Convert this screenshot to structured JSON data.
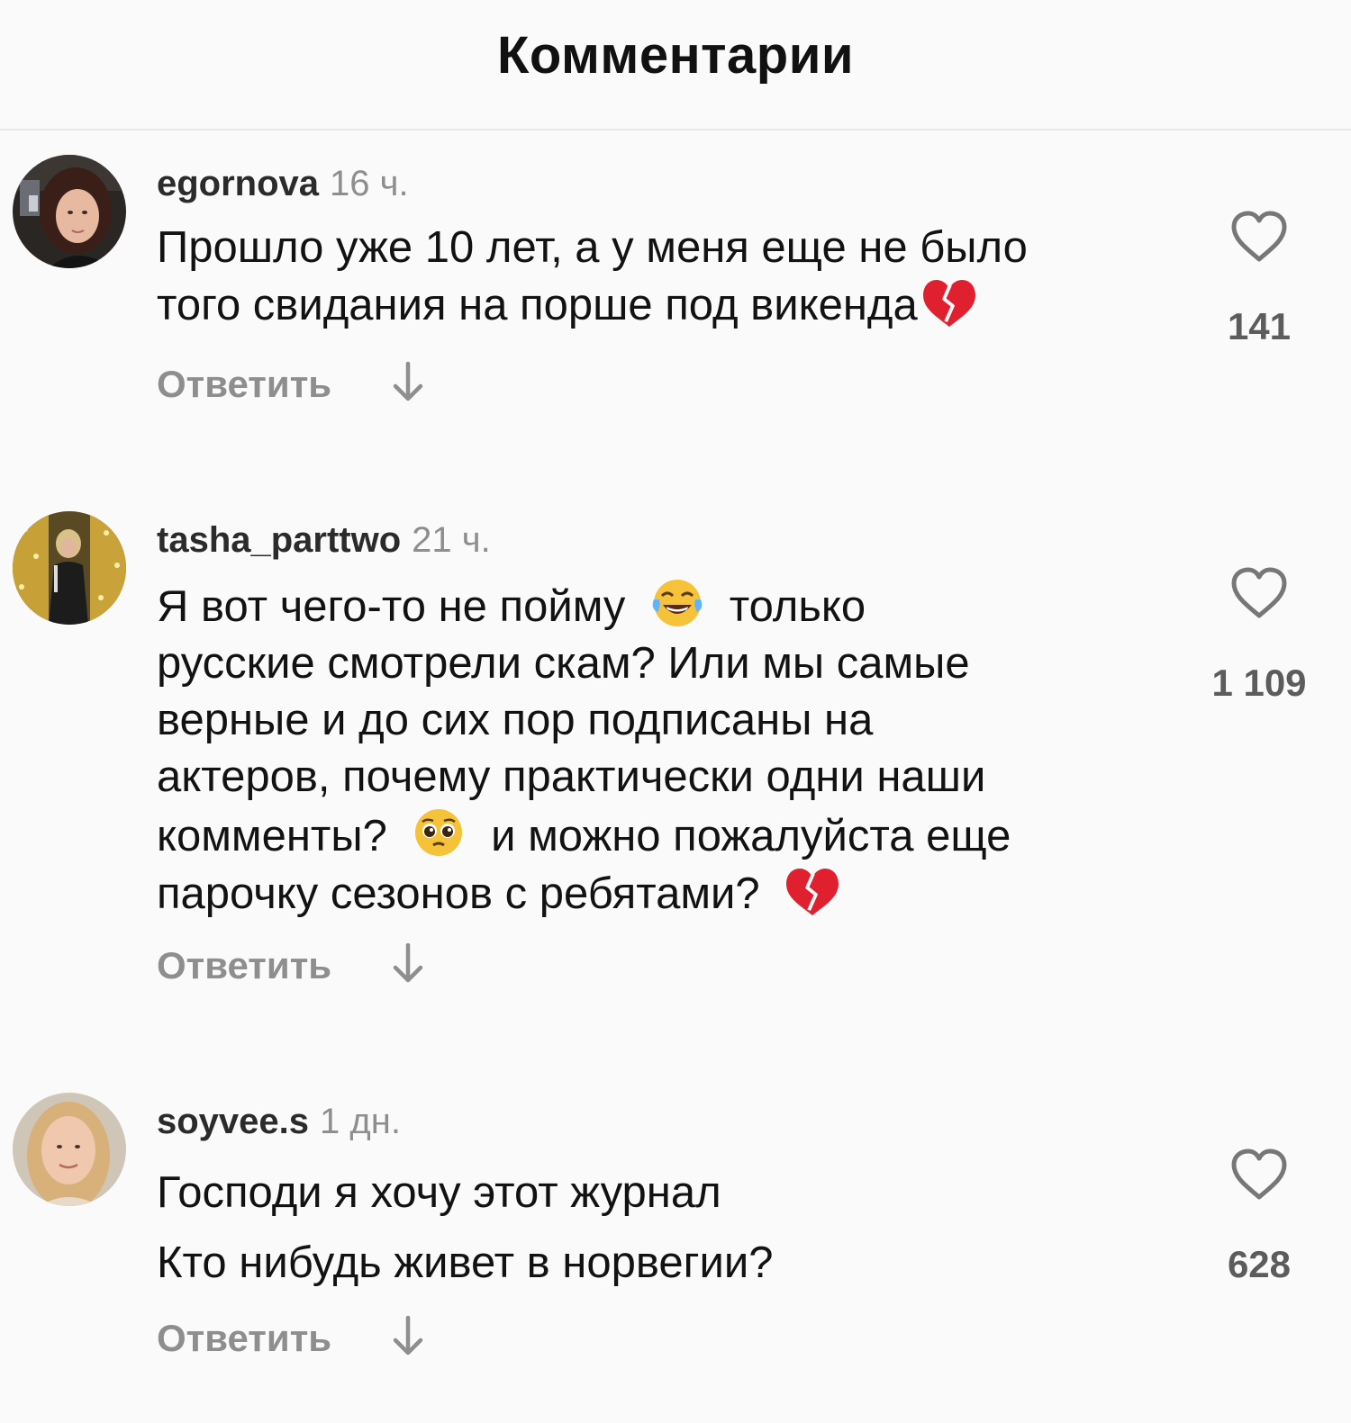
{
  "header": {
    "title": "Комментарии"
  },
  "comments": [
    {
      "username": "egornova",
      "time": "16 ч.",
      "lines": [
        "Прошло уже 10 лет, а у меня еще не было",
        "того свидания на порше под викенда"
      ],
      "emojis": [
        "broken-heart"
      ],
      "likes": "141",
      "reply_label": "Ответить"
    },
    {
      "username": "tasha_parttwo",
      "time": "21 ч.",
      "lines": [
        "Я вот чего-то не пойму",
        "только",
        "русские смотрели скам? Или мы самые",
        "верные и до сих пор подписаны на",
        "актеров, почему практически одни наши",
        "комменты?",
        "и можно пожалуйста еще",
        "парочку сезонов с ребятами?"
      ],
      "emojis": [
        "face-with-tears-of-joy",
        "pleading-face",
        "broken-heart"
      ],
      "likes": "1 109",
      "reply_label": "Ответить"
    },
    {
      "username": "soyvee.s",
      "time": "1 дн.",
      "lines": [
        "Господи я хочу этот журнал",
        "Кто нибудь живет в норвегии?"
      ],
      "emojis": [],
      "likes": "628",
      "reply_label": "Ответить"
    }
  ],
  "icons": {
    "like": "heart-outline-icon",
    "expand": "arrow-down-icon"
  },
  "colors": {
    "background": "#fafafa",
    "username": "#2b2b2b",
    "secondary_text": "#8e8e8e",
    "broken_heart": "#e0202e"
  }
}
